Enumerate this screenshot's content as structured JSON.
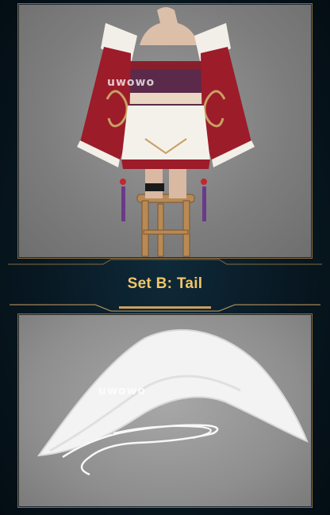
{
  "watermark_top": "uwowo",
  "watermark_bottom": "uwowo",
  "section": {
    "title": "Set B: Tail"
  },
  "colors": {
    "gold": "#c9a063",
    "title": "#f0c668",
    "background": "#07161f"
  }
}
